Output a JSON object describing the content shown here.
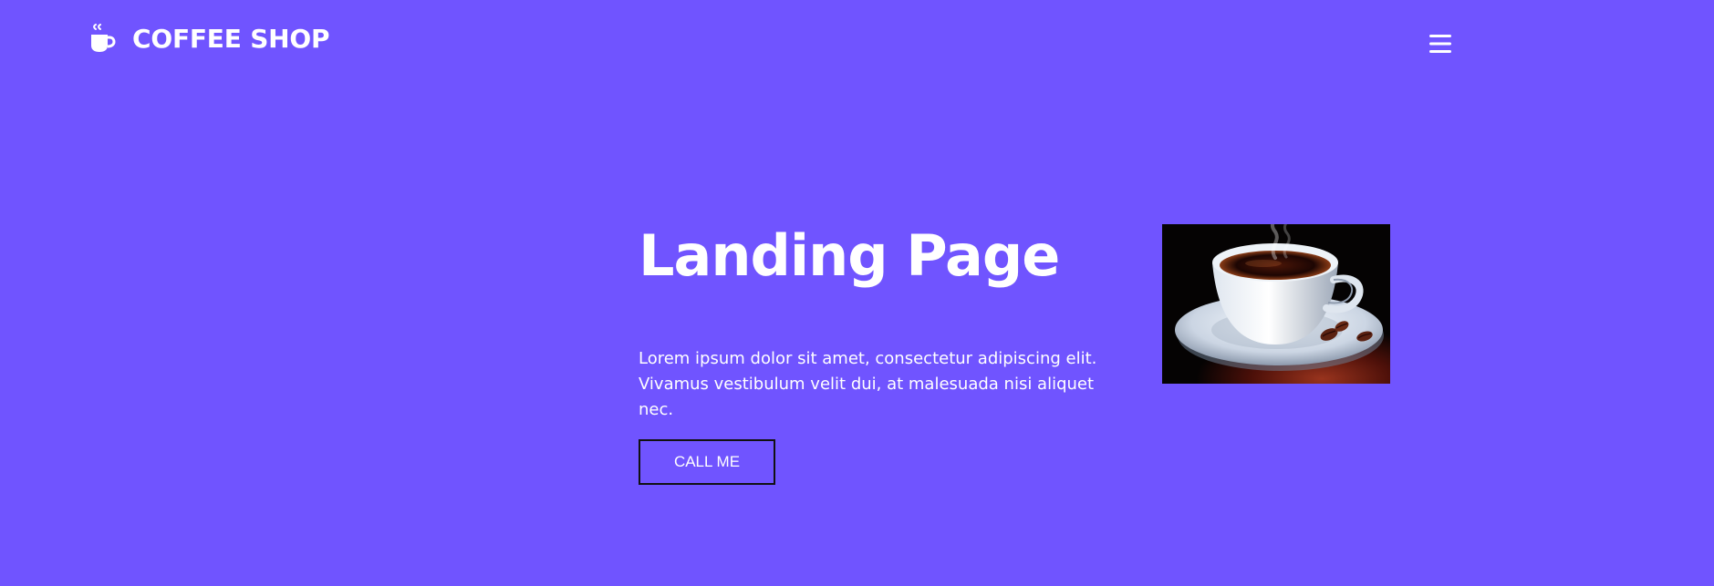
{
  "header": {
    "brand_icon": "coffee-cup-icon",
    "brand_title": "COFFEE SHOP",
    "menu_icon": "hamburger-menu-icon"
  },
  "hero": {
    "title": "Landing Page",
    "description": "Lorem ipsum dolor sit amet, consectetur adipiscing elit. Vivamus vestibulum velit dui, at malesuada nisi aliquet nec.",
    "button_label": "CALL ME",
    "image_subject": "coffee-cup-photo"
  },
  "colors": {
    "background": "#7054ff",
    "text": "#ffffff",
    "button_border": "#111111"
  }
}
